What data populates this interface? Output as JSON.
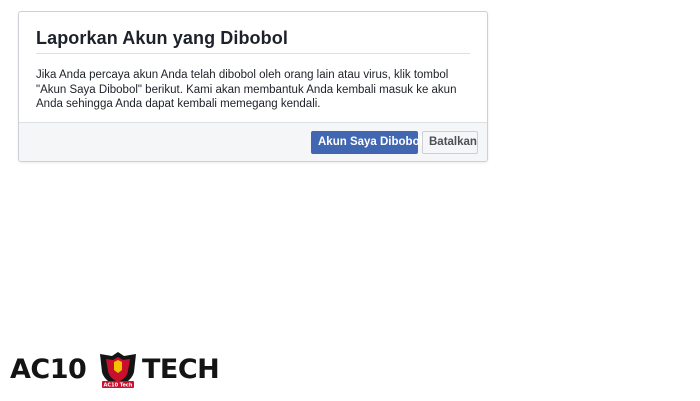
{
  "dialog": {
    "title": "Laporkan Akun yang Dibobol",
    "body": "Jika Anda percaya akun Anda telah dibobol oleh orang lain atau virus, klik tombol \"Akun Saya Dibobol\" berikut. Kami akan membantuk Anda kembali masuk ke akun Anda sehingga Anda dapat kembali memegang kendali.",
    "primary_label": "Akun Saya Dibobol",
    "secondary_label": "Batalkan"
  },
  "watermark": {
    "left_text": "AC10",
    "right_text": "TECH",
    "badge_text": "AC10 Tech"
  },
  "colors": {
    "primary": "#4267b2",
    "emblem_red": "#c8102e",
    "emblem_yellow": "#f2c200"
  }
}
